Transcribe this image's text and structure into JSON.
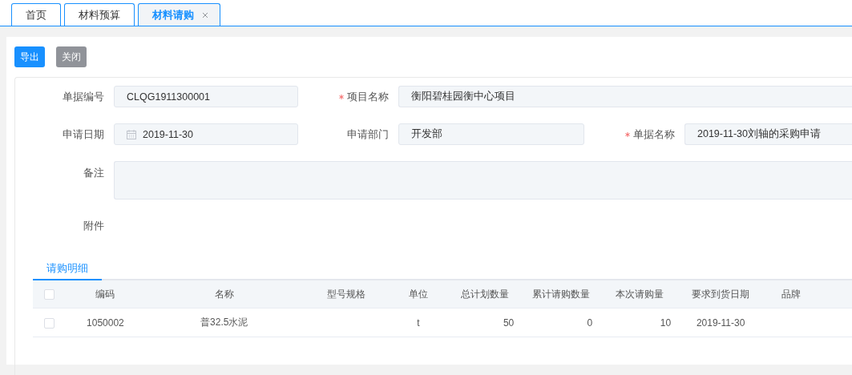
{
  "tabs": [
    {
      "label": "首页",
      "selected": false,
      "closable": false
    },
    {
      "label": "材料预算",
      "selected": false,
      "closable": false
    },
    {
      "label": "材料请购",
      "selected": true,
      "closable": true
    }
  ],
  "toolbar": [
    {
      "label": "导出",
      "kind": "primary"
    },
    {
      "label": "关闭",
      "kind": "secondary"
    }
  ],
  "form": {
    "fields": [
      {
        "label": "单据编号",
        "value": "CLQG1911300001",
        "required": false,
        "kind": "text"
      },
      {
        "label": "项目名称",
        "value": "衡阳碧桂园衡中心项目",
        "required": true,
        "kind": "text"
      },
      {
        "label": "申请日期",
        "value": "2019-11-30",
        "required": false,
        "kind": "date"
      },
      {
        "label": "申请部门",
        "value": "开发部",
        "required": false,
        "kind": "text"
      },
      {
        "label": "单据名称",
        "value": "2019-11-30刘轴的采购申请",
        "required": true,
        "kind": "text"
      },
      {
        "label": "备注",
        "required": false,
        "kind": "textarea"
      },
      {
        "label": "附件",
        "required": false,
        "kind": "none"
      }
    ]
  },
  "detail_tabs": [
    {
      "label": "请购明细",
      "selected": true
    }
  ],
  "table": {
    "columns": [
      "编码",
      "名称",
      "型号规格",
      "单位",
      "总计划数量",
      "累计请购数量",
      "本次请购量",
      "要求到货日期",
      "品牌"
    ],
    "header_checked": false,
    "rows": [
      {
        "checked": false,
        "cells": [
          "1050002",
          "普32.5水泥",
          "",
          "t",
          "50",
          "0",
          "10",
          "2019-11-30",
          ""
        ]
      }
    ]
  }
}
